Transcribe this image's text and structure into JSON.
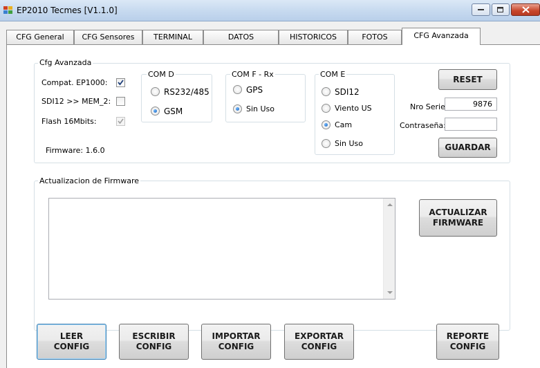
{
  "window": {
    "title": "EP2010 Tecmes  [V1.1.0]"
  },
  "tabs": [
    {
      "label": "CFG General",
      "active": false
    },
    {
      "label": "CFG Sensores",
      "active": false
    },
    {
      "label": "TERMINAL",
      "active": false
    },
    {
      "label": "DATOS",
      "active": false
    },
    {
      "label": "HISTORICOS",
      "active": false
    },
    {
      "label": "FOTOS",
      "active": false
    },
    {
      "label": "CFG Avanzada",
      "active": true
    }
  ],
  "cfg_avanzada": {
    "legend": "Cfg Avanzada",
    "compat_label": "Compat. EP1000:",
    "compat_checked": true,
    "sdi12_label": "SDI12 >> MEM_2:",
    "sdi12_checked": false,
    "flash_label": "Flash 16Mbits:",
    "flash_checked": true,
    "flash_enabled": false,
    "firmware_label": "Firmware: 1.6.0",
    "com_d": {
      "legend": "COM D",
      "options": [
        "RS232/485",
        "GSM"
      ],
      "selected": "GSM"
    },
    "com_f": {
      "legend": "COM F - Rx",
      "options": [
        "GPS",
        "Sin Uso"
      ],
      "selected": "Sin Uso"
    },
    "com_e": {
      "legend": "COM E",
      "options": [
        "SDI12",
        "Viento US",
        "Cam",
        "Sin Uso"
      ],
      "selected": "Cam"
    },
    "reset_label": "RESET",
    "serie_label": "Nro Serie:",
    "serie_value": "9876",
    "password_label": "Contraseña:",
    "password_value": "",
    "guardar_label": "GUARDAR"
  },
  "firmware_update": {
    "legend": "Actualizacion de Firmware",
    "log_text": "",
    "button_label": "ACTUALIZAR\nFIRMWARE"
  },
  "bottom_buttons": {
    "leer": "LEER\nCONFIG",
    "escribir": "ESCRIBIR\nCONFIG",
    "importar": "IMPORTAR\nCONFIG",
    "exportar": "EXPORTAR\nCONFIG",
    "reporte": "REPORTE\nCONFIG"
  },
  "colors": {
    "accent": "#1a5fb4",
    "close_button": "#c8462b",
    "tab_page_bg": "#ffffff",
    "window_bg": "#f0f0f0"
  }
}
